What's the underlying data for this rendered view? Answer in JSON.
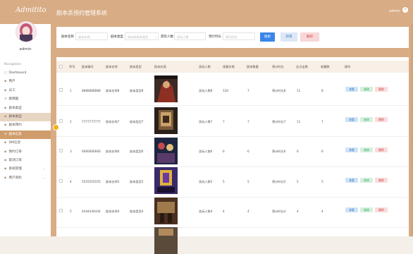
{
  "header": {
    "logo": "Admitito",
    "title": "剧本杀预约管理系统",
    "user": "admin",
    "close_glyph": "×"
  },
  "sidebar": {
    "username": "admin",
    "nav_caption": "Navigation",
    "items": [
      {
        "icon": "○",
        "label": "Dashboard"
      },
      {
        "icon": "▪",
        "label": "用户"
      },
      {
        "icon": "▪",
        "label": "员工"
      },
      {
        "icon": "≡",
        "label": "剧情图"
      },
      {
        "icon": "▪",
        "label": "剧本类型"
      },
      {
        "icon": "▪",
        "label": "剧本类型"
      },
      {
        "icon": "▪",
        "label": "剧本预约"
      },
      {
        "icon": "≡",
        "label": "剧本信息"
      },
      {
        "icon": "▪",
        "label": "DM信息"
      },
      {
        "icon": "▪",
        "label": "预约订单"
      },
      {
        "icon": "▪",
        "label": "取消订单"
      },
      {
        "icon": "▪",
        "label": "系统管理",
        "arrow": "⌄"
      },
      {
        "icon": "▪",
        "label": "用户资料",
        "arrow": "⌄"
      }
    ]
  },
  "search": {
    "name_label": "剧本名称",
    "name_placeholder": "剧本名称",
    "type_label": "剧本类型",
    "type_placeholder": "请选择剧本类型",
    "players_label": "游玩人数",
    "players_placeholder": "游玩人数",
    "time_label": "预计时长",
    "time_placeholder": "预计时长",
    "search_btn": "搜索",
    "add_btn": "新增",
    "delete_btn": "删除"
  },
  "table": {
    "headers": [
      "序号",
      "剧本编号",
      "剧本名称",
      "剧本类型",
      "剧本封面",
      "游玩人数",
      "观看价格",
      "剧本数量",
      "预计时长",
      "总点击数",
      "收藏数",
      "操作"
    ],
    "rows": [
      {
        "idx": "1",
        "code": "8888888888",
        "name": "剧本名称8",
        "type": "剧本类型8",
        "players": "游玩人数8",
        "price": "120",
        "count": "7",
        "duration": "预计时长8",
        "clicks": "11",
        "fav": "8"
      },
      {
        "idx": "2",
        "code": "7777777777",
        "name": "剧本名称7",
        "type": "剧本类型7",
        "players": "游玩人数7",
        "price": "7",
        "count": "7",
        "duration": "预计时长7",
        "clicks": "11",
        "fav": "7"
      },
      {
        "idx": "3",
        "code": "6666666666",
        "name": "剧本名称6",
        "type": "剧本类型6",
        "players": "游玩人数6",
        "price": "6",
        "count": "6",
        "duration": "预计时长6",
        "clicks": "6",
        "fav": "6"
      },
      {
        "idx": "4",
        "code": "5555555555",
        "name": "剧本名称5",
        "type": "剧本类型5",
        "players": "游玩人数5",
        "price": "5",
        "count": "5",
        "duration": "预计时长5",
        "clicks": "5",
        "fav": "5"
      },
      {
        "idx": "5",
        "code": "4444444444",
        "name": "剧本名称4",
        "type": "剧本类型4",
        "players": "游玩人数4",
        "price": "4",
        "count": "4",
        "duration": "预计时长4",
        "clicks": "4",
        "fav": "4"
      }
    ],
    "actions": {
      "view": "查看",
      "edit": "修改",
      "delete": "删除"
    }
  },
  "colors": {
    "accent": "#d8ac84",
    "search": "#3a86e8",
    "add": "#dde8f6",
    "delete": "#f8d7d7"
  }
}
